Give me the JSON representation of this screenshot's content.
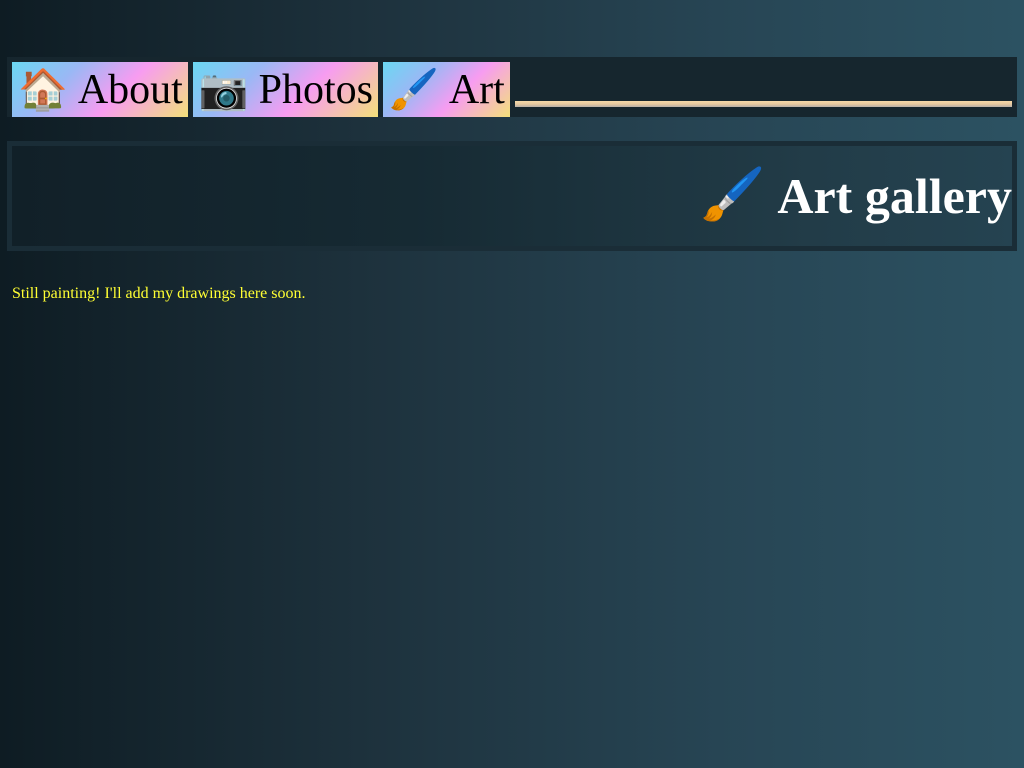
{
  "nav": {
    "tabs": [
      {
        "icon": "🏠",
        "icon_name": "house-icon",
        "label": "About"
      },
      {
        "icon": "📷",
        "icon_name": "camera-icon",
        "label": "Photos"
      },
      {
        "icon": "🖌️",
        "icon_name": "paintbrush-icon",
        "label": "Art"
      }
    ]
  },
  "hero": {
    "icon": "🖌️",
    "icon_name": "paintbrush-icon",
    "title": "Art gallery"
  },
  "main": {
    "note": "Still painting! I'll add my drawings here soon."
  },
  "colors": {
    "note_text": "#ffff33",
    "title_text": "#ffffff",
    "tab_gradient": [
      "#6ad8f2",
      "#f79cf1",
      "#f3e07a"
    ]
  }
}
